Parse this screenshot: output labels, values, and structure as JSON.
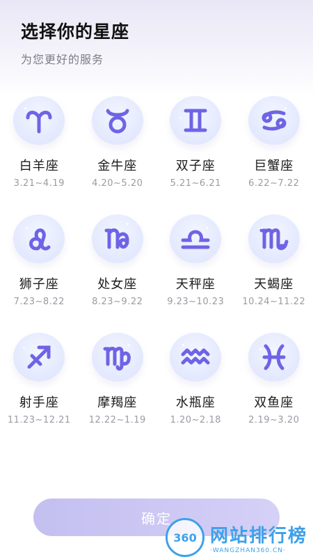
{
  "header": {
    "title": "选择你的星座",
    "subtitle": "为您更好的服务"
  },
  "zodiac": [
    {
      "name": "白羊座",
      "date": "3.21~4.19",
      "icon": "aries-icon"
    },
    {
      "name": "金牛座",
      "date": "4.20~5.20",
      "icon": "taurus-icon"
    },
    {
      "name": "双子座",
      "date": "5.21~6.21",
      "icon": "gemini-icon"
    },
    {
      "name": "巨蟹座",
      "date": "6.22~7.22",
      "icon": "cancer-icon"
    },
    {
      "name": "狮子座",
      "date": "7.23~8.22",
      "icon": "leo-icon"
    },
    {
      "name": "处女座",
      "date": "8.23~9.22",
      "icon": "capricorn-like-icon"
    },
    {
      "name": "天秤座",
      "date": "9.23~10.23",
      "icon": "libra-icon"
    },
    {
      "name": "天蝎座",
      "date": "10.24~11.22",
      "icon": "scorpio-icon"
    },
    {
      "name": "射手座",
      "date": "11.23~12.21",
      "icon": "sagittarius-icon"
    },
    {
      "name": "摩羯座",
      "date": "12.22~1.19",
      "icon": "virgo-like-icon"
    },
    {
      "name": "水瓶座",
      "date": "1.20~2.18",
      "icon": "aquarius-icon"
    },
    {
      "name": "双鱼座",
      "date": "2.19~3.20",
      "icon": "pisces-icon"
    }
  ],
  "confirm_label": "确定",
  "watermark": {
    "logo": "360",
    "text": "网站排行榜",
    "sub": "·WANGZHAN360.CN·"
  },
  "colors": {
    "icon_stroke": "#6f64e6",
    "button": "#c9c5f3"
  }
}
